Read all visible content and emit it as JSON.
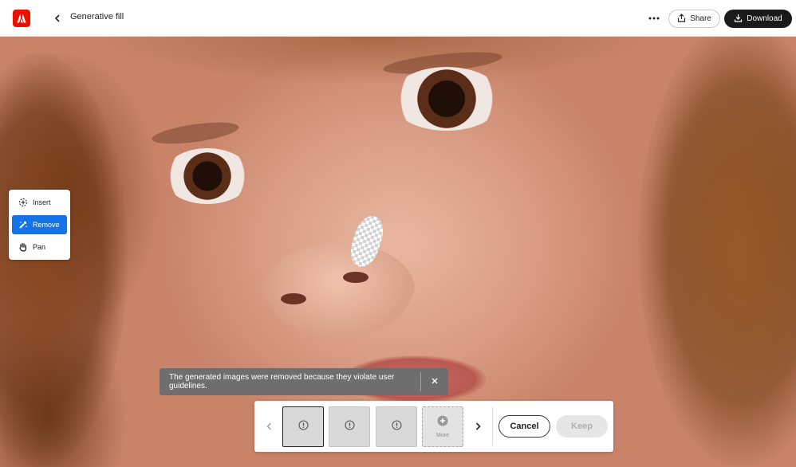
{
  "header": {
    "title": "Generative fill",
    "share_label": "Share",
    "download_label": "Download"
  },
  "tools": {
    "items": [
      {
        "label": "Insert",
        "icon": "insert-icon",
        "active": false
      },
      {
        "label": "Remove",
        "icon": "remove-icon",
        "active": true
      },
      {
        "label": "Pan",
        "icon": "hand-icon",
        "active": false
      }
    ]
  },
  "toast": {
    "message": "The generated images were removed because they violate user guidelines."
  },
  "variants": {
    "thumbnails": [
      {
        "icon": "warning-icon",
        "selected": true
      },
      {
        "icon": "warning-icon",
        "selected": false
      },
      {
        "icon": "warning-icon",
        "selected": false
      }
    ],
    "more_label": "More",
    "cancel_label": "Cancel",
    "keep_label": "Keep"
  },
  "colors": {
    "accent": "#1473e6",
    "brand": "#eb1000",
    "primary_button": "#1a1a1a"
  }
}
